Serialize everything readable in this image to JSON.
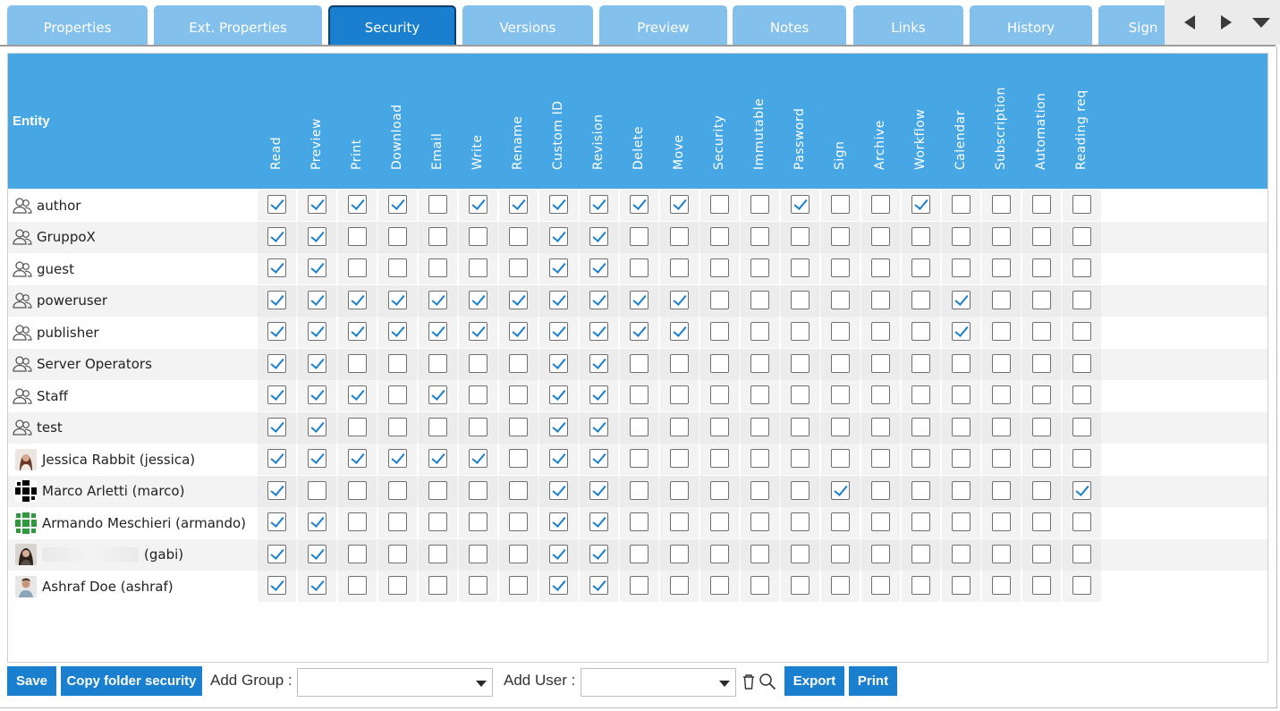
{
  "tabs": [
    {
      "label": "Properties",
      "active": false
    },
    {
      "label": "Ext. Properties",
      "active": false
    },
    {
      "label": "Security",
      "active": true
    },
    {
      "label": "Versions",
      "active": false
    },
    {
      "label": "Preview",
      "active": false
    },
    {
      "label": "Notes",
      "active": false
    },
    {
      "label": "Links",
      "active": false
    },
    {
      "label": "History",
      "active": false
    },
    {
      "label": "Sign",
      "active": false
    }
  ],
  "tab_nav_icons": [
    "triangle-left-icon",
    "triangle-right-icon",
    "triangle-down-icon"
  ],
  "grid": {
    "entity_header": "Entity",
    "columns": [
      "Read",
      "Preview",
      "Print",
      "Download",
      "Email",
      "Write",
      "Rename",
      "Custom ID",
      "Revision",
      "Delete",
      "Move",
      "Security",
      "Immutable",
      "Password",
      "Sign",
      "Archive",
      "Workflow",
      "Calendar",
      "Subscription",
      "Automation",
      "Reading req"
    ],
    "rows": [
      {
        "name": "author",
        "kind": "group",
        "perms": [
          1,
          1,
          1,
          1,
          0,
          1,
          1,
          1,
          1,
          1,
          1,
          0,
          0,
          1,
          0,
          0,
          1,
          0,
          0,
          0,
          0
        ]
      },
      {
        "name": "GruppoX",
        "kind": "group",
        "perms": [
          1,
          1,
          0,
          0,
          0,
          0,
          0,
          1,
          1,
          0,
          0,
          0,
          0,
          0,
          0,
          0,
          0,
          0,
          0,
          0,
          0
        ]
      },
      {
        "name": "guest",
        "kind": "group",
        "perms": [
          1,
          1,
          0,
          0,
          0,
          0,
          0,
          1,
          1,
          0,
          0,
          0,
          0,
          0,
          0,
          0,
          0,
          0,
          0,
          0,
          0
        ]
      },
      {
        "name": "poweruser",
        "kind": "group",
        "perms": [
          1,
          1,
          1,
          1,
          1,
          1,
          1,
          1,
          1,
          1,
          1,
          0,
          0,
          0,
          0,
          0,
          0,
          1,
          0,
          0,
          0
        ]
      },
      {
        "name": "publisher",
        "kind": "group",
        "perms": [
          1,
          1,
          1,
          1,
          1,
          1,
          1,
          1,
          1,
          1,
          1,
          0,
          0,
          0,
          0,
          0,
          0,
          1,
          0,
          0,
          0
        ]
      },
      {
        "name": "Server Operators",
        "kind": "group",
        "perms": [
          1,
          1,
          0,
          0,
          0,
          0,
          0,
          1,
          1,
          0,
          0,
          0,
          0,
          0,
          0,
          0,
          0,
          0,
          0,
          0,
          0
        ]
      },
      {
        "name": "Staff",
        "kind": "group",
        "perms": [
          1,
          1,
          1,
          0,
          1,
          0,
          0,
          1,
          1,
          0,
          0,
          0,
          0,
          0,
          0,
          0,
          0,
          0,
          0,
          0,
          0
        ]
      },
      {
        "name": "test",
        "kind": "group",
        "perms": [
          1,
          1,
          0,
          0,
          0,
          0,
          0,
          1,
          1,
          0,
          0,
          0,
          0,
          0,
          0,
          0,
          0,
          0,
          0,
          0,
          0
        ]
      },
      {
        "name": "Jessica Rabbit (jessica)",
        "kind": "user",
        "avatar": "photo-woman",
        "perms": [
          1,
          1,
          1,
          1,
          1,
          1,
          0,
          1,
          1,
          0,
          0,
          0,
          0,
          0,
          0,
          0,
          0,
          0,
          0,
          0,
          0
        ]
      },
      {
        "name": "Marco Arletti (marco)",
        "kind": "user",
        "avatar": "pattern-black",
        "perms": [
          1,
          0,
          0,
          0,
          0,
          0,
          0,
          1,
          1,
          0,
          0,
          0,
          0,
          0,
          1,
          0,
          0,
          0,
          0,
          0,
          1
        ]
      },
      {
        "name": "Armando Meschieri (armando)",
        "kind": "user",
        "avatar": "pattern-green",
        "perms": [
          1,
          1,
          0,
          0,
          0,
          0,
          0,
          1,
          1,
          0,
          0,
          0,
          0,
          0,
          0,
          0,
          0,
          0,
          0,
          0,
          0
        ]
      },
      {
        "name": "(gabi)",
        "kind": "user",
        "avatar": "photo-woman-2",
        "redacted": true,
        "perms": [
          1,
          1,
          0,
          0,
          0,
          0,
          0,
          1,
          1,
          0,
          0,
          0,
          0,
          0,
          0,
          0,
          0,
          0,
          0,
          0,
          0
        ]
      },
      {
        "name": "Ashraf Doe (ashraf)",
        "kind": "user",
        "avatar": "photo-man",
        "perms": [
          1,
          1,
          0,
          0,
          0,
          0,
          0,
          1,
          1,
          0,
          0,
          0,
          0,
          0,
          0,
          0,
          0,
          0,
          0,
          0,
          0
        ]
      }
    ]
  },
  "toolbar": {
    "save_label": "Save",
    "copy_label": "Copy folder security",
    "add_group_label": "Add Group :",
    "add_group_value": "",
    "add_user_label": "Add User :",
    "add_user_value": "",
    "export_label": "Export",
    "print_label": "Print",
    "icons": [
      "trash-icon",
      "search-icon"
    ]
  },
  "colors": {
    "accent": "#1a7fce",
    "header_bg": "#47a6e4",
    "tab_bg": "#84c0ec"
  }
}
